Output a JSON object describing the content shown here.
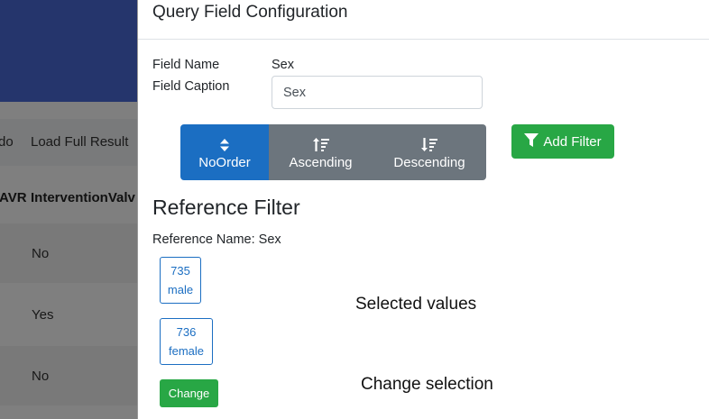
{
  "background": {
    "toolbar": {
      "partial_label": "do",
      "load_label": "Load Full Result"
    },
    "columns": [
      "AVR",
      "InterventionValv"
    ],
    "rows": [
      "No",
      "Yes",
      "No"
    ]
  },
  "panel": {
    "title": "Query Field Configuration",
    "field_name_label": "Field Name",
    "field_name_value": "Sex",
    "field_caption_label": "Field Caption",
    "field_caption_value": "Sex",
    "order_buttons": [
      {
        "label": "NoOrder",
        "icon": "sort-icon",
        "active": true
      },
      {
        "label": "Ascending",
        "icon": "sort-ascending-icon",
        "active": false
      },
      {
        "label": "Descending",
        "icon": "sort-descending-icon",
        "active": false
      }
    ],
    "add_filter_label": "Add Filter",
    "reference_filter_title": "Reference Filter",
    "reference_name_text": "Reference Name: Sex",
    "selected_values": [
      {
        "id": "735",
        "label": "male"
      },
      {
        "id": "736",
        "label": "female"
      }
    ],
    "change_label": "Change"
  },
  "annotations": {
    "selected_values": "Selected values",
    "change_selection": "Change selection"
  },
  "colors": {
    "primary": "#1b6ec2",
    "secondary": "#6c757d",
    "success": "#28a745",
    "header": "#4a6ad8"
  }
}
